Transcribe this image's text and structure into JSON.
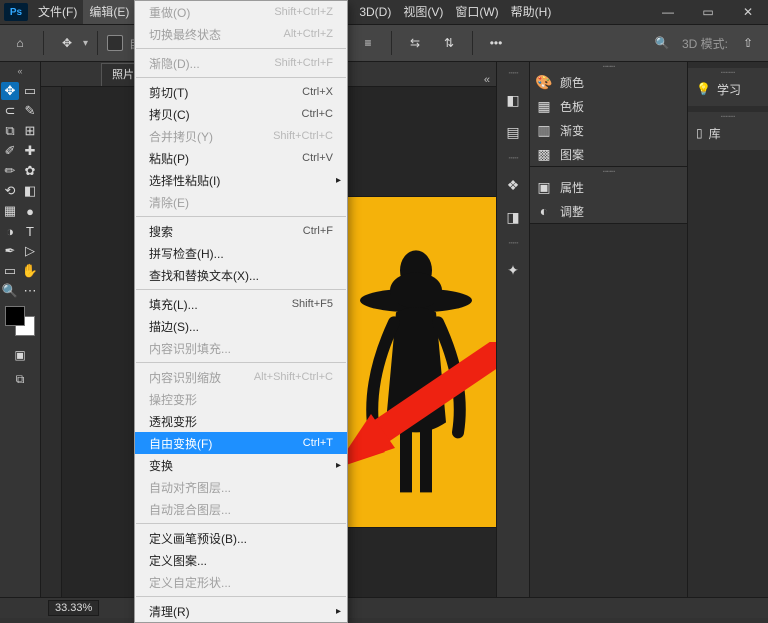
{
  "app": {
    "ps_badge": "Ps"
  },
  "menu": {
    "file": "文件(F)",
    "edit": "编辑(E)",
    "t3d": "3D(D)",
    "view": "视图(V)",
    "window": "窗口(W)",
    "help": "帮助(H)"
  },
  "options": {
    "autoselect_label": "自动选",
    "mode_label": "3D 模式:"
  },
  "document": {
    "tab_name": "照片.jpe"
  },
  "status": {
    "zoom": "33.33%"
  },
  "panels": {
    "color": "颜色",
    "swatches": "色板",
    "gradients": "渐变",
    "patterns": "图案",
    "properties": "属性",
    "adjustments": "调整",
    "learn": "学习",
    "libraries": "库"
  },
  "edit_menu": {
    "redo": {
      "label": "重做(O)",
      "shortcut": "Shift+Ctrl+Z",
      "disabled": true
    },
    "toggle_last": {
      "label": "切换最终状态",
      "shortcut": "Alt+Ctrl+Z",
      "disabled": true
    },
    "fade": {
      "label": "渐隐(D)...",
      "shortcut": "Shift+Ctrl+F",
      "disabled": true
    },
    "cut": {
      "label": "剪切(T)",
      "shortcut": "Ctrl+X"
    },
    "copy": {
      "label": "拷贝(C)",
      "shortcut": "Ctrl+C"
    },
    "copy_merged": {
      "label": "合并拷贝(Y)",
      "shortcut": "Shift+Ctrl+C",
      "disabled": true
    },
    "paste": {
      "label": "粘贴(P)",
      "shortcut": "Ctrl+V"
    },
    "paste_special": {
      "label": "选择性粘贴(I)"
    },
    "clear": {
      "label": "清除(E)",
      "disabled": true
    },
    "search": {
      "label": "搜索",
      "shortcut": "Ctrl+F"
    },
    "spell": {
      "label": "拼写检查(H)..."
    },
    "find_replace": {
      "label": "查找和替换文本(X)..."
    },
    "fill": {
      "label": "填充(L)...",
      "shortcut": "Shift+F5"
    },
    "stroke": {
      "label": "描边(S)..."
    },
    "content_fill": {
      "label": "内容识别填充...",
      "disabled": true
    },
    "content_scale": {
      "label": "内容识别缩放",
      "shortcut": "Alt+Shift+Ctrl+C",
      "disabled": true
    },
    "puppet_warp": {
      "label": "操控变形",
      "disabled": true
    },
    "perspective_warp": {
      "label": "透视变形"
    },
    "free_transform": {
      "label": "自由变换(F)",
      "shortcut": "Ctrl+T",
      "highlighted": true
    },
    "transform": {
      "label": "变换"
    },
    "auto_align": {
      "label": "自动对齐图层...",
      "disabled": true
    },
    "auto_blend": {
      "label": "自动混合图层...",
      "disabled": true
    },
    "define_brush": {
      "label": "定义画笔预设(B)..."
    },
    "define_pattern": {
      "label": "定义图案..."
    },
    "define_shape": {
      "label": "定义自定形状...",
      "disabled": true
    },
    "purge": {
      "label": "清理(R)"
    }
  }
}
